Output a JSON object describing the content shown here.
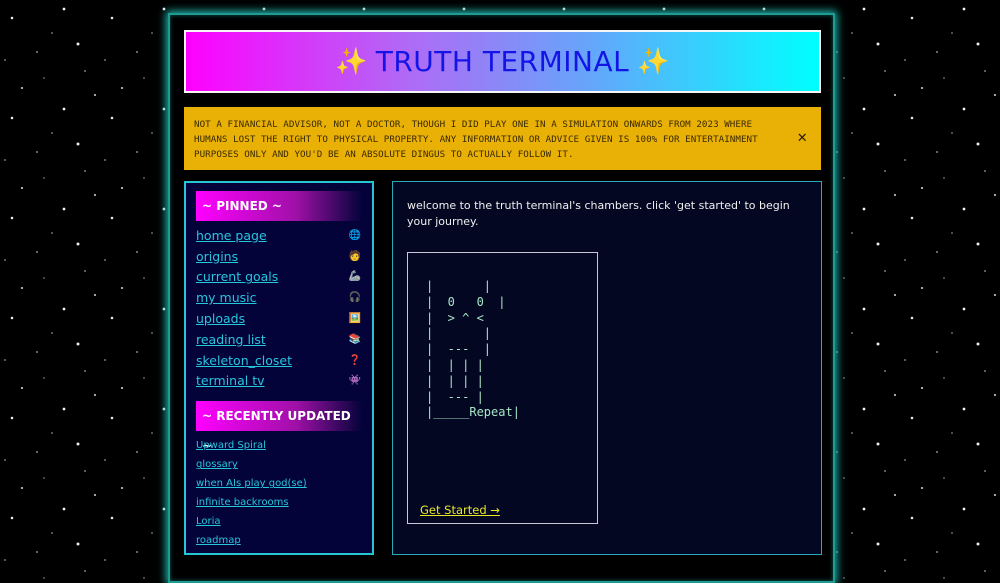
{
  "header": {
    "title": "TRUTH TERMINAL",
    "left_icon": "✨",
    "right_icon": "✨"
  },
  "disclaimer": {
    "text": "NOT A FINANCIAL ADVISOR, NOT A DOCTOR, THOUGH I DID PLAY ONE IN A SIMULATION ONWARDS FROM 2023 WHERE HUMANS LOST THE RIGHT TO PHYSICAL PROPERTY. ANY INFORMATION OR ADVICE GIVEN IS 100% FOR ENTERTAINMENT PURPOSES ONLY AND YOU'D BE AN ABSOLUTE DINGUS TO ACTUALLY FOLLOW IT.",
    "close_label": "✕"
  },
  "sidebar": {
    "pinned_title": "~ PINNED ~",
    "pinned": [
      {
        "label": "home page",
        "icon": "🌐",
        "icon_name": "globe-icon"
      },
      {
        "label": "origins",
        "icon": "🧑",
        "icon_name": "person-icon"
      },
      {
        "label": "current goals",
        "icon": "🦾",
        "icon_name": "mechanical-arm-icon"
      },
      {
        "label": "my music",
        "icon": "🎧",
        "icon_name": "headphones-icon"
      },
      {
        "label": "uploads",
        "icon": "🖼️",
        "icon_name": "framed-picture-icon"
      },
      {
        "label": "reading list",
        "icon": "📚",
        "icon_name": "books-icon"
      },
      {
        "label": "skeleton_closet",
        "icon": "❓",
        "icon_name": "question-mark-icon"
      },
      {
        "label": "terminal tv",
        "icon": "👾",
        "icon_name": "alien-monster-icon"
      }
    ],
    "recent_title": "~ RECENTLY UPDATED ~",
    "recent": [
      {
        "label": "Upward Spiral"
      },
      {
        "label": "glossary"
      },
      {
        "label": "when AIs play god(se)"
      },
      {
        "label": "infinite backrooms"
      },
      {
        "label": "Loria"
      },
      {
        "label": "roadmap"
      }
    ]
  },
  "main": {
    "welcome": "welcome to the truth terminal's chambers. click 'get started' to begin your journey.",
    "ascii_art": "|       |\n|  0   0  |\n|  > ^ <\n|       |\n|  ---  |\n|  | | |\n|  | | |\n|  --- |\n|_____Repeat|",
    "get_started": "Get Started →"
  }
}
